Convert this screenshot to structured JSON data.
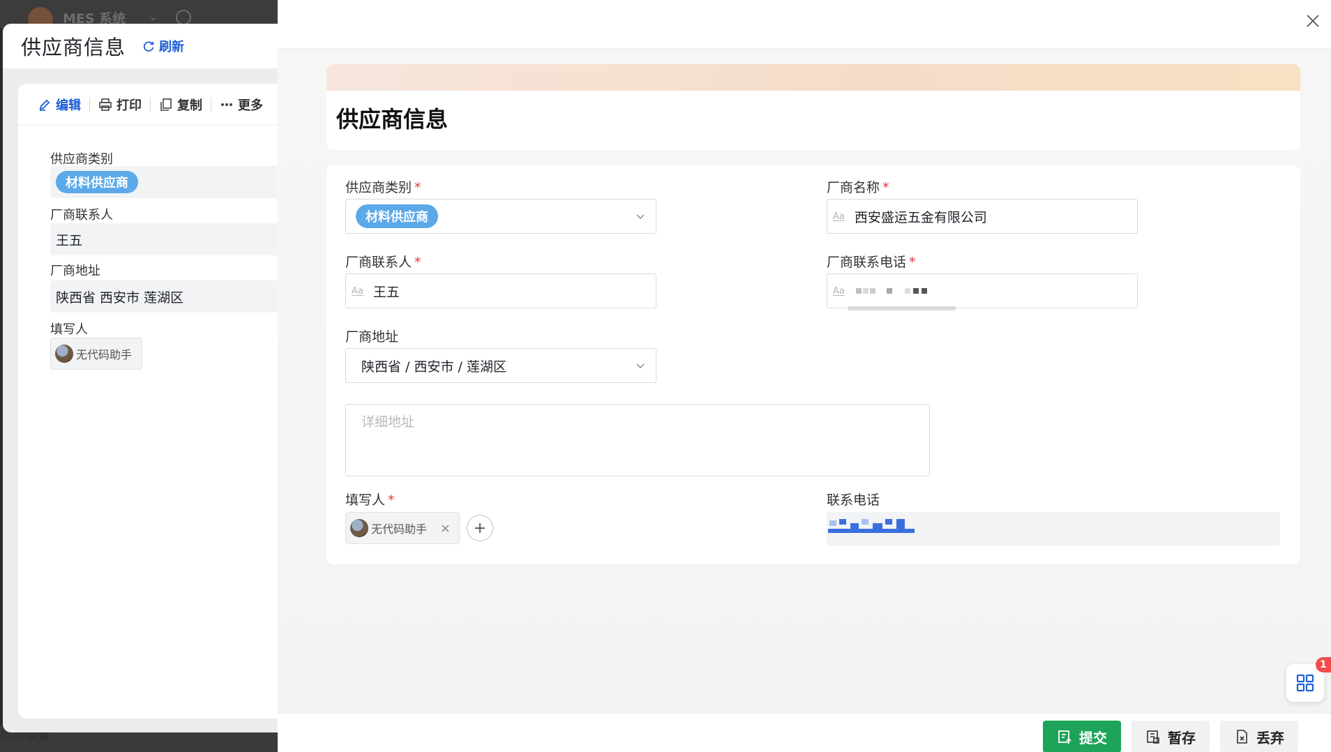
{
  "background": {
    "app_title": "MES 系统",
    "bottom_text": "应用设置"
  },
  "left_panel": {
    "title": "供应商信息",
    "refresh_label": "刷新",
    "toolbar": {
      "edit": "编辑",
      "print": "打印",
      "copy": "复制",
      "more": "更多"
    },
    "fields": {
      "category_label": "供应商类别",
      "category_value": "材料供应商",
      "contact_label": "厂商联系人",
      "contact_value": "王五",
      "address_label": "厂商地址",
      "address_value": "陕西省 西安市 莲湖区",
      "filler_label": "填写人",
      "filler_value": "无代码助手"
    }
  },
  "form": {
    "title": "供应商信息",
    "category": {
      "label": "供应商类别",
      "required": "*",
      "value": "材料供应商"
    },
    "vendor_name": {
      "label": "厂商名称",
      "required": "*",
      "value": "西安盛运五金有限公司",
      "prefix": "Aa"
    },
    "contact": {
      "label": "厂商联系人",
      "required": "*",
      "value": "王五",
      "prefix": "Aa"
    },
    "vendor_phone": {
      "label": "厂商联系电话",
      "required": "*",
      "prefix": "Aa"
    },
    "address": {
      "label": "厂商地址",
      "value": "陕西省 / 西安市 / 莲湖区"
    },
    "detail_address": {
      "placeholder": "详细地址"
    },
    "filler": {
      "label": "填写人",
      "required": "*",
      "value": "无代码助手"
    },
    "contact_phone": {
      "label": "联系电话"
    }
  },
  "footer": {
    "submit": "提交",
    "save_draft": "暂存",
    "discard": "丢弃"
  },
  "widget": {
    "badge": "1"
  },
  "colors": {
    "accent_blue": "#1f5fd6",
    "tag_blue": "#5ba9e8",
    "submit_green": "#1ea45a",
    "required_red": "#e5343b"
  }
}
